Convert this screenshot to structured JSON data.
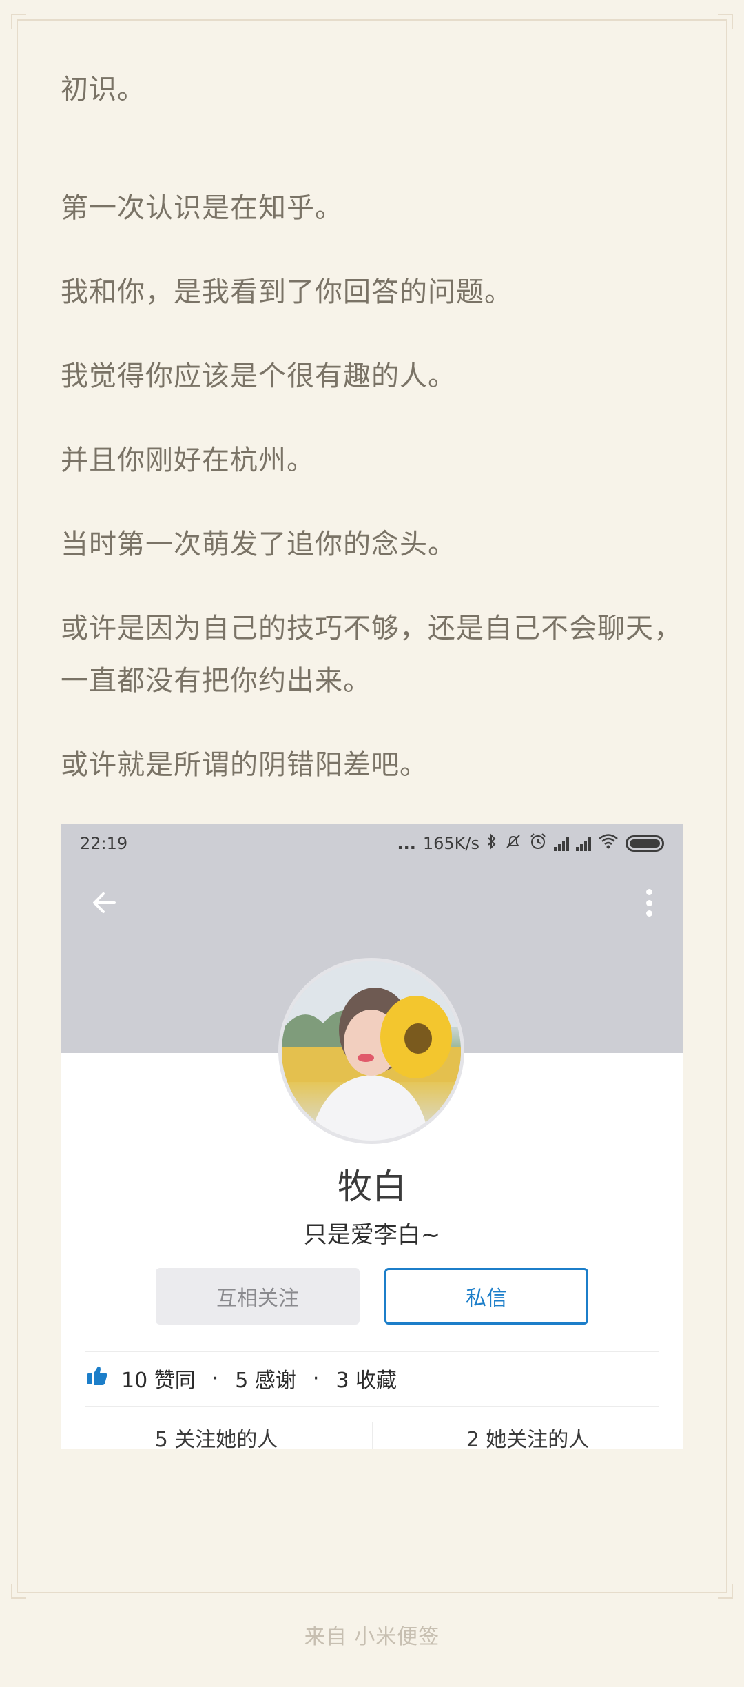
{
  "note": {
    "paragraphs": [
      "初识。",
      "第一次认识是在知乎。",
      "我和你，是我看到了你回答的问题。",
      "我觉得你应该是个很有趣的人。",
      "并且你刚好在杭州。",
      "当时第一次萌发了追你的念头。",
      "或许是因为自己的技巧不够，还是自己不会聊天，一直都没有把你约出来。",
      "或许就是所谓的阴错阳差吧。"
    ]
  },
  "screenshot": {
    "status_bar": {
      "time": "22:19",
      "dots": "...",
      "speed": "165K/s"
    },
    "profile": {
      "name": "牧白",
      "bio": "只是爱李白~",
      "follow_button": "互相关注",
      "message_button": "私信",
      "stats": {
        "likes": "10 赞同",
        "thanks": "5 感谢",
        "collections": "3 收藏",
        "separator": "·"
      },
      "followers": "5 关注她的人",
      "following": "2 她关注的人"
    },
    "colors": {
      "header_bg": "#cdced4",
      "accent": "#1c7ec9",
      "like_icon": "#1c7ec9"
    }
  },
  "footer": {
    "source": "来自 小米便签"
  }
}
